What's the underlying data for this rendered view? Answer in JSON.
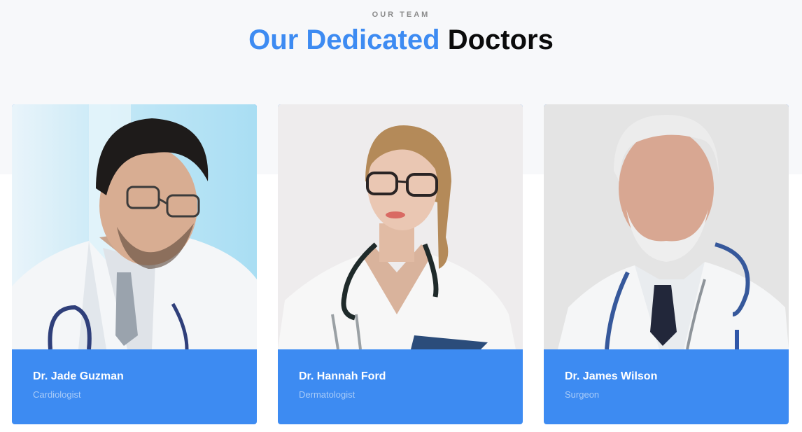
{
  "section": {
    "eyebrow": "OUR TEAM",
    "title_accent": "Our Dedicated",
    "title_rest": "Doctors"
  },
  "doctors": [
    {
      "name": "Dr. Jade Guzman",
      "specialty": "Cardiologist"
    },
    {
      "name": "Dr. Hannah Ford",
      "specialty": "Dermatologist"
    },
    {
      "name": "Dr. James Wilson",
      "specialty": "Surgeon"
    }
  ],
  "colors": {
    "accent": "#3d8bf2",
    "heading_dark": "#0b0b0b",
    "band_background": "#f7f8fa"
  }
}
